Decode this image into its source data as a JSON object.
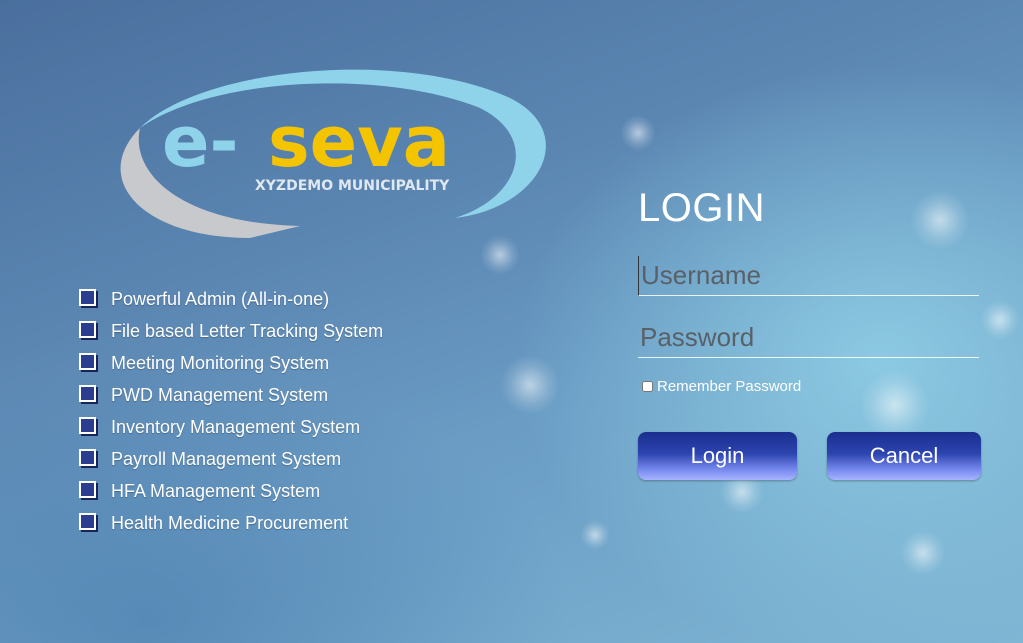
{
  "logo": {
    "brand_e": "e-",
    "brand_seva": "seva",
    "municipality": "XYZDEMO MUNICIPALITY"
  },
  "features": [
    "Powerful Admin (All-in-one)",
    "File based Letter Tracking System",
    "Meeting Monitoring System",
    "PWD Management System",
    "Inventory Management System",
    "Payroll Management System",
    "HFA Management System",
    "Health Medicine Procurement"
  ],
  "login": {
    "title": "LOGIN",
    "username_placeholder": "Username",
    "password_placeholder": "Password",
    "remember_label": "Remember Password",
    "login_button": "Login",
    "cancel_button": "Cancel"
  },
  "colors": {
    "logo_e": "#8fd3ea",
    "logo_seva": "#f5c400",
    "button_top": "#1b2e8f",
    "button_bottom": "#a7b4ff"
  }
}
